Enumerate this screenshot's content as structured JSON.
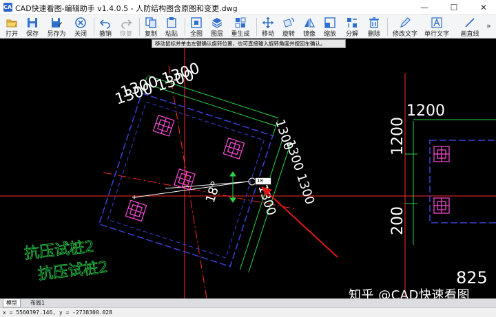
{
  "window": {
    "title": "CAD快速看图-编辑助手 v1.4.0.5 - 人防结构图含原图和变更.dwg",
    "app_icon_text": "CAD",
    "minimize_glyph": "—",
    "maximize_glyph": "☐",
    "close_glyph": "✕"
  },
  "toolbar": {
    "open": "打开",
    "save": "保存",
    "save_as": "另存为",
    "close": "关闭",
    "undo": "撤销",
    "redo": "恢复",
    "copy": "复制",
    "paste": "粘贴",
    "zoom_all": "全图",
    "layers": "图层",
    "regen": "重生成",
    "move": "移动",
    "rotate": "旋转",
    "mirror": "镜像",
    "scale": "缩放",
    "explode": "分解",
    "delete": "删除",
    "edit_text": "修改文字",
    "single_text": "单行文字",
    "draw_line": "画直线",
    "more": "»",
    "more_label": ""
  },
  "tooltip": "移动鼠标并单击左键确认旋转位置，也可直接输入旋转角度并按回车确认。",
  "angle_input_value": "18",
  "drawing": {
    "dims_top_left": "1300 1300",
    "dims_top_left_2": "1300 1300",
    "dim_rot_1": "1300",
    "dim_rot_2": "1300 1300",
    "dim_rot_3": "1300",
    "angle_text": "18°",
    "dim_1200_h": "1200",
    "dim_1200_v": "1200",
    "dim_200": "200",
    "dim_825": "825",
    "pile_label_1": "抗压试桩2",
    "pile_label_2": "抗压试桩2"
  },
  "watermark": "知乎 @CAD快速看图",
  "layout_tabs": [
    "模型",
    "布局1"
  ],
  "status": "x = 5560397.146, y = -2738300.028",
  "colors": {
    "canvas_bg": "#000000",
    "cyan": "#00d7ff",
    "green": "#2ad44a",
    "magenta": "#ff4dd8",
    "red": "#ff2a2a",
    "blue_dash": "#3a43d8",
    "arrow": "#e01818"
  }
}
